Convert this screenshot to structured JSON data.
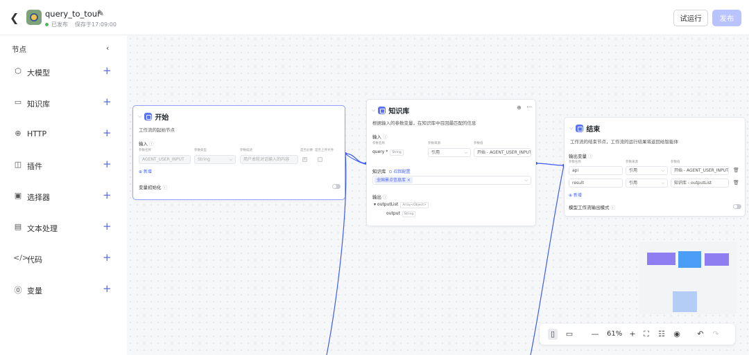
{
  "header": {
    "title": "query_to_tour",
    "status": "已发布",
    "saved": "保存于17:09:00",
    "test_button": "试运行",
    "publish_button": "发布"
  },
  "sidebar": {
    "title": "节点",
    "items": [
      {
        "label": "大模型",
        "icon": "cube-icon",
        "glyph": "⬡"
      },
      {
        "label": "知识库",
        "icon": "monitor-icon",
        "glyph": "▭"
      },
      {
        "label": "HTTP",
        "icon": "globe-icon",
        "glyph": "⊕"
      },
      {
        "label": "插件",
        "icon": "plugin-icon",
        "glyph": "◫"
      },
      {
        "label": "选择器",
        "icon": "if-icon",
        "glyph": "▣"
      },
      {
        "label": "文本处理",
        "icon": "text-icon",
        "glyph": "▤"
      },
      {
        "label": "代码",
        "icon": "code-icon",
        "glyph": "</>"
      },
      {
        "label": "变量",
        "icon": "variable-icon",
        "glyph": "⓪"
      }
    ]
  },
  "start_node": {
    "title": "开始",
    "desc": "工作流的起始节点",
    "input_label": "输入",
    "cols": [
      "参数名称",
      "参数类型",
      "参数描述",
      "是否必要",
      "是否上传文件"
    ],
    "param_name": "AGENT_USER_INPUT",
    "param_type": "String",
    "param_desc": "用户本轮对话输入的内容",
    "add": "新增",
    "var_init": "变量初始化"
  },
  "kb_node": {
    "title": "知识库",
    "desc": "根据输入的参数变量，在知识库中召回最匹配的信息",
    "input_label": "输入",
    "cols": [
      "参数名称",
      "参数来源",
      "参数值"
    ],
    "param_name": "query",
    "param_tag": "String",
    "param_source": "引用",
    "param_value": "开始 - AGENT_USER_INPUT",
    "kb_label": "知识库",
    "recall": "召回配置",
    "kb_chip": "全国景点信息库 ×",
    "output_label": "输出",
    "out1": "outputList",
    "out1_tag": "Array<Object>",
    "out2": "output",
    "out2_tag": "String"
  },
  "end_node": {
    "title": "结束",
    "desc": "工作流的结束节点，工作流的运行结果将返回给智能体",
    "output_label": "输出变量",
    "cols": [
      "参数名称",
      "参数来源",
      "参数值"
    ],
    "rows": [
      {
        "name": "api",
        "source": "引用",
        "value": "开始 - AGENT_USER_INPUT"
      },
      {
        "name": "result",
        "source": "引用",
        "value": "知识库 - outputList"
      }
    ],
    "add": "新增",
    "stream": "模型工作流输出模式"
  },
  "toolbar": {
    "zoom": "61%"
  }
}
